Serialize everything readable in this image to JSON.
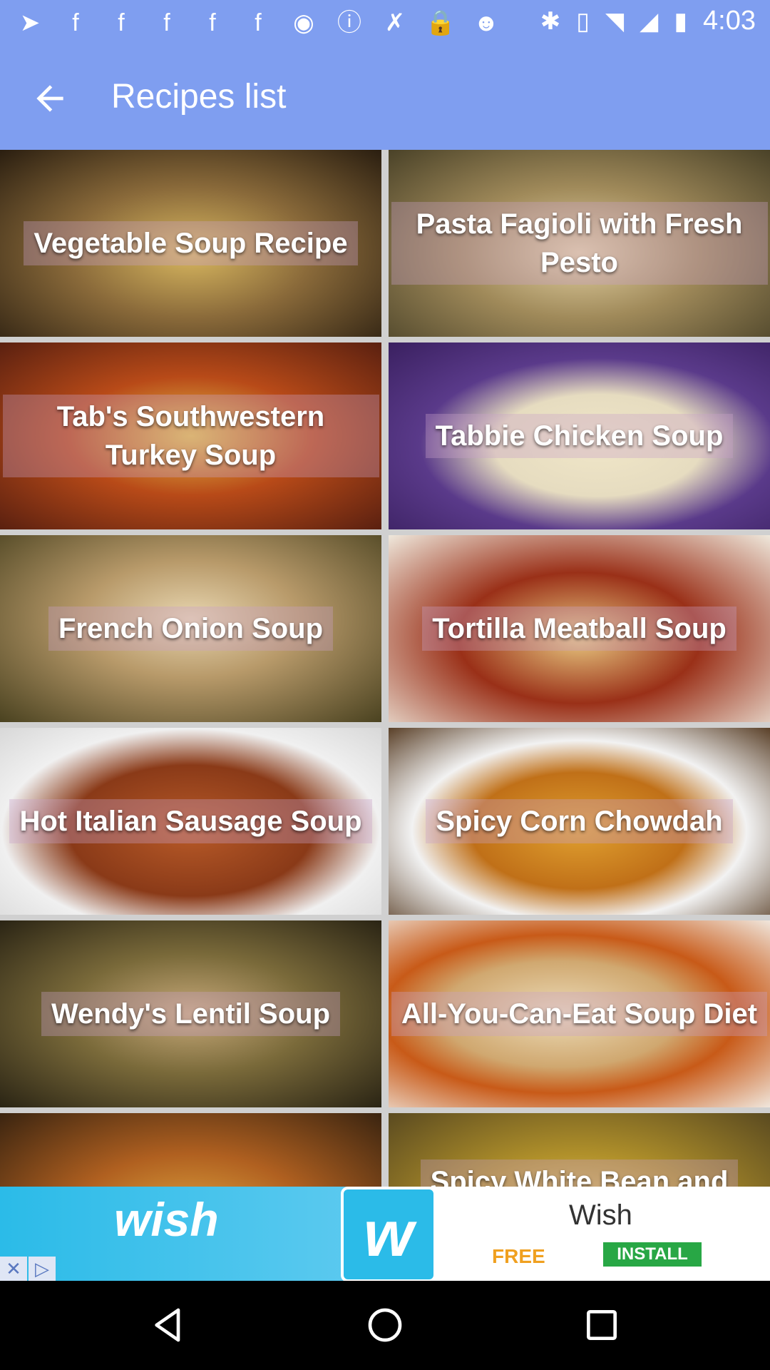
{
  "status_bar": {
    "time": "4:03",
    "icons": [
      "navigation-icon",
      "fb-icon",
      "fb-icon",
      "fb-icon",
      "fb-icon",
      "fb-icon",
      "record-icon",
      "info-icon",
      "no-signal-icon",
      "lock-icon",
      "android-icon"
    ],
    "right_icons": [
      "bluetooth-icon",
      "vibrate-icon",
      "wifi-icon",
      "cellular-icon",
      "battery-icon"
    ]
  },
  "app_bar": {
    "title": "Recipes list",
    "back_icon": "arrow-left-icon"
  },
  "recipes": [
    {
      "label": "Vegetable Soup Recipe",
      "color_a": "#5b4a2c",
      "color_b": "#e6c640"
    },
    {
      "label": "Pasta Fagioli with Fresh Pesto",
      "color_a": "#7a6b3c",
      "color_b": "#c2a46c"
    },
    {
      "label": "Tab's Southwestern Turkey Soup",
      "color_a": "#a33a12",
      "color_b": "#e5c24a"
    },
    {
      "label": "Tabbie Chicken Soup",
      "color_a": "#4b2a7a",
      "color_b": "#e8dfc0"
    },
    {
      "label": "French Onion Soup",
      "color_a": "#5b4d1f",
      "color_b": "#d9c29b"
    },
    {
      "label": "Tortilla Meatball Soup",
      "color_a": "#8a2818",
      "color_b": "#ecd9a6"
    },
    {
      "label": "Hot Italian Sausage Soup",
      "color_a": "#9c4020",
      "color_b": "#eeeeee"
    },
    {
      "label": "Spicy Corn Chowdah",
      "color_a": "#6a4a2a",
      "color_b": "#d89a30"
    },
    {
      "label": "Wendy's Lentil Soup",
      "color_a": "#4b4a2a",
      "color_b": "#b8a27a"
    },
    {
      "label": "All-You-Can-Eat Soup Diet",
      "color_a": "#c06020",
      "color_b": "#e8d8b8"
    },
    {
      "label": "",
      "color_a": "#6a3a18",
      "color_b": "#d8a040"
    },
    {
      "label": "Spicy White Bean and",
      "color_a": "#7a6a30",
      "color_b": "#e0c070"
    }
  ],
  "ad": {
    "logo_text": "wish",
    "icon_letter": "w",
    "app_name": "Wish",
    "price": "FREE",
    "cta": "INSTALL",
    "close_icon": "close-icon",
    "adchoices_icon": "adchoices-icon"
  },
  "nav_bar": {
    "back": "back-triangle-icon",
    "home": "home-circle-icon",
    "recents": "recents-square-icon"
  }
}
